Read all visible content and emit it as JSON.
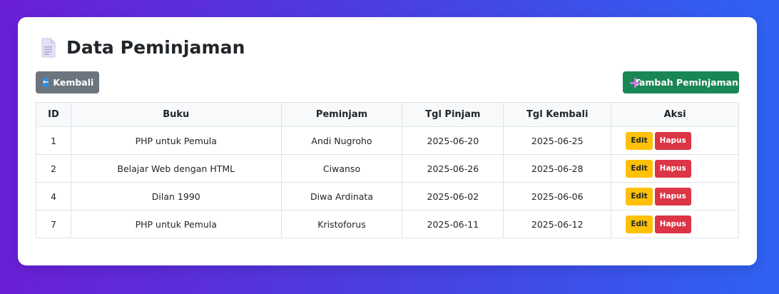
{
  "page": {
    "title": "Data Peminjaman",
    "title_icon": "document-icon"
  },
  "toolbar": {
    "back_label": "Kembali",
    "back_icon": "arrow-left-icon",
    "add_label": "Tambah Peminjaman",
    "add_icon": "plus-icon"
  },
  "table": {
    "headers": [
      "ID",
      "Buku",
      "Peminjam",
      "Tgl Pinjam",
      "Tgl Kembali",
      "Aksi"
    ],
    "rows": [
      {
        "id": "1",
        "buku": "PHP untuk Pemula",
        "peminjam": "Andi Nugroho",
        "tgl_pinjam": "2025-06-20",
        "tgl_kembali": "2025-06-25"
      },
      {
        "id": "2",
        "buku": "Belajar Web dengan HTML",
        "peminjam": "Ciwanso",
        "tgl_pinjam": "2025-06-26",
        "tgl_kembali": "2025-06-28"
      },
      {
        "id": "4",
        "buku": "Dilan 1990",
        "peminjam": "Diwa Ardinata",
        "tgl_pinjam": "2025-06-02",
        "tgl_kembali": "2025-06-06"
      },
      {
        "id": "7",
        "buku": "PHP untuk Pemula",
        "peminjam": "Kristoforus",
        "tgl_pinjam": "2025-06-11",
        "tgl_kembali": "2025-06-12"
      }
    ],
    "edit_label": "Edit",
    "delete_label": "Hapus"
  },
  "colors": {
    "background_start": "#6a1fd6",
    "background_end": "#2f62f2",
    "back_button": "#6c757d",
    "add_button": "#198754",
    "edit_button": "#ffc107",
    "delete_button": "#dc3545"
  }
}
